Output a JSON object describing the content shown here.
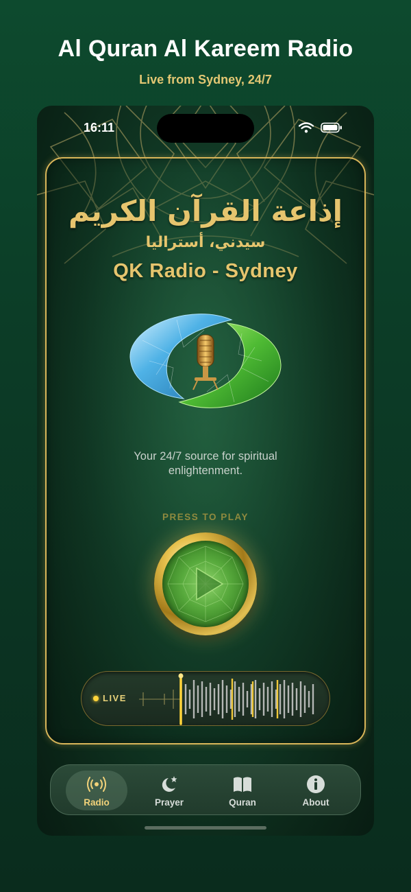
{
  "promo": {
    "title": "Al Quran Al Kareem Radio",
    "subtitle": "Live from Sydney, 24/7"
  },
  "status_bar": {
    "time": "16:11",
    "icons": [
      "wifi-icon",
      "battery-icon"
    ]
  },
  "header": {
    "arabic_title": "إذاعة القرآن الكريم",
    "arabic_subtitle": "سيدني، أستراليا",
    "station_name": "QK Radio - Sydney"
  },
  "tagline": "Your 24/7 source for spiritual enlightenment.",
  "player": {
    "press_label": "PRESS TO PLAY",
    "live_label": "LIVE"
  },
  "tabs": [
    {
      "label": "Radio",
      "icon": "radio-icon",
      "active": true
    },
    {
      "label": "Prayer",
      "icon": "moon-star-icon",
      "active": false
    },
    {
      "label": "Quran",
      "icon": "book-icon",
      "active": false
    },
    {
      "label": "About",
      "icon": "info-icon",
      "active": false
    }
  ],
  "colors": {
    "gold": "#e6c56e",
    "background_green": "#0c3d27",
    "active_tab_label": "#f2d27a"
  }
}
